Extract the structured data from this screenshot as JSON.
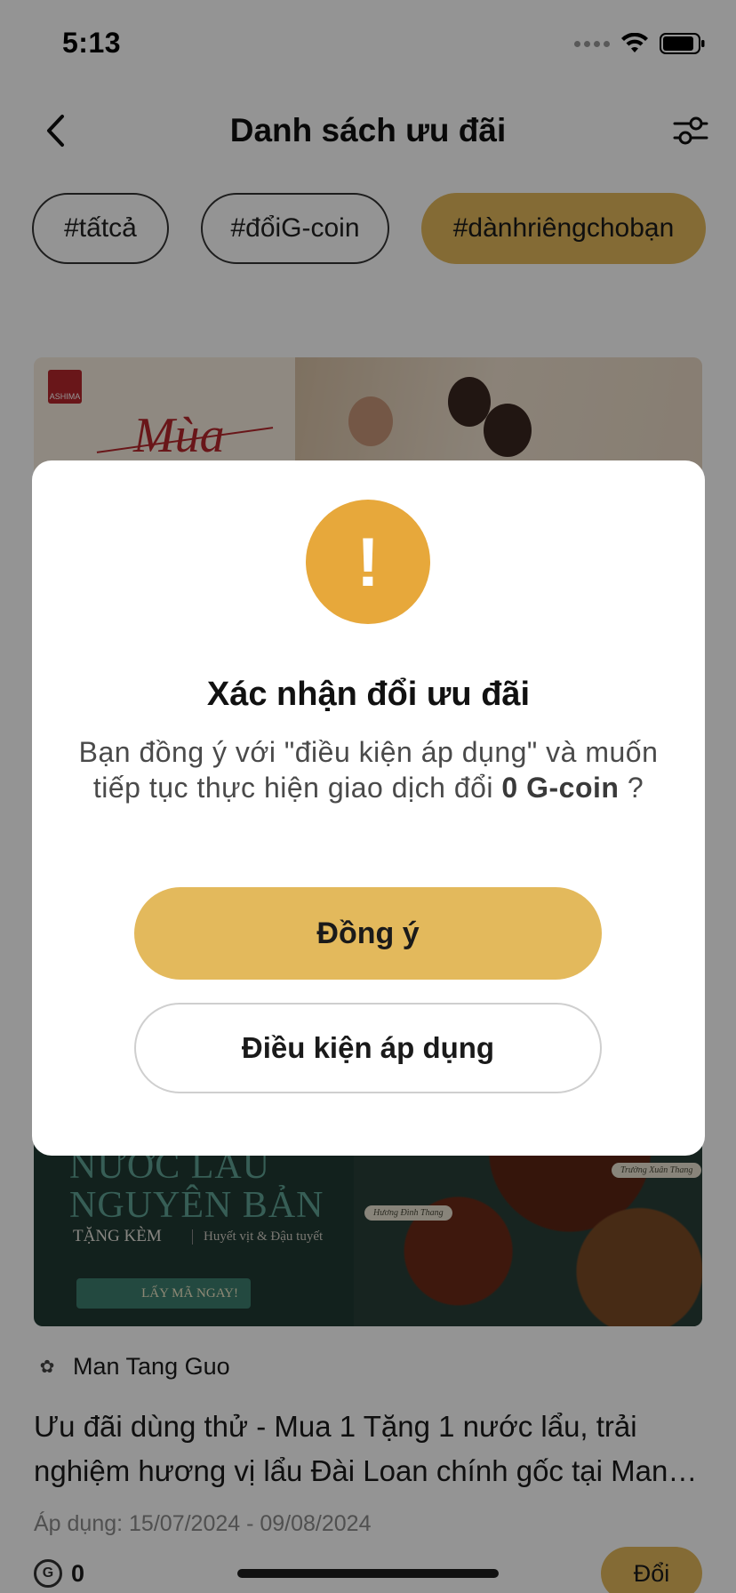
{
  "status_bar": {
    "time": "5:13"
  },
  "header": {
    "title": "Danh sách ưu đãi"
  },
  "tags": [
    {
      "label": "#tấtcả",
      "active": false
    },
    {
      "label": "#đổiG-coin",
      "active": false
    },
    {
      "label": "#dànhriêngchobạn",
      "active": true
    }
  ],
  "card_1": {
    "brand_logo": "ASHIMA",
    "banner_text": "Mùa"
  },
  "card_2": {
    "banner_line1": "NƯỚC LẨU",
    "banner_line2": "NGUYÊN BẢN",
    "banner_gift": "TẶNG KÈM",
    "banner_gift_detail": "Huyết vịt & Đậu tuyết",
    "banner_cta": "LẤY MÃ NGAY!",
    "banner_tag_1": "Hương Đình Thang",
    "banner_tag_2": "Trường Xuân Thang",
    "merchant_name": "Man Tang Guo",
    "offer_title": "Ưu đãi dùng thử - Mua 1 Tặng 1 nước lẩu, trải nghiệm hương vị lẩu Đài Loan chính gốc tại Man Tang Guo",
    "dates": "Áp dụng: 15/07/2024 - 09/08/2024",
    "coin_value": "0",
    "redeem_label": "Đổi"
  },
  "modal": {
    "icon": "exclamation-icon",
    "title": "Xác nhận đổi ưu đãi",
    "message_prefix": "Bạn đồng ý với \"điều kiện áp dụng\" và muốn tiếp tục thực hiện giao dịch đổi ",
    "message_amount": "0  G-coin",
    "message_suffix": " ?",
    "confirm_label": "Đồng ý",
    "terms_label": "Điều kiện áp dụng"
  },
  "colors": {
    "accent": "#e3b95c",
    "warning_icon": "#e7a83b",
    "overlay": "rgba(0,0,0,0.42)"
  }
}
